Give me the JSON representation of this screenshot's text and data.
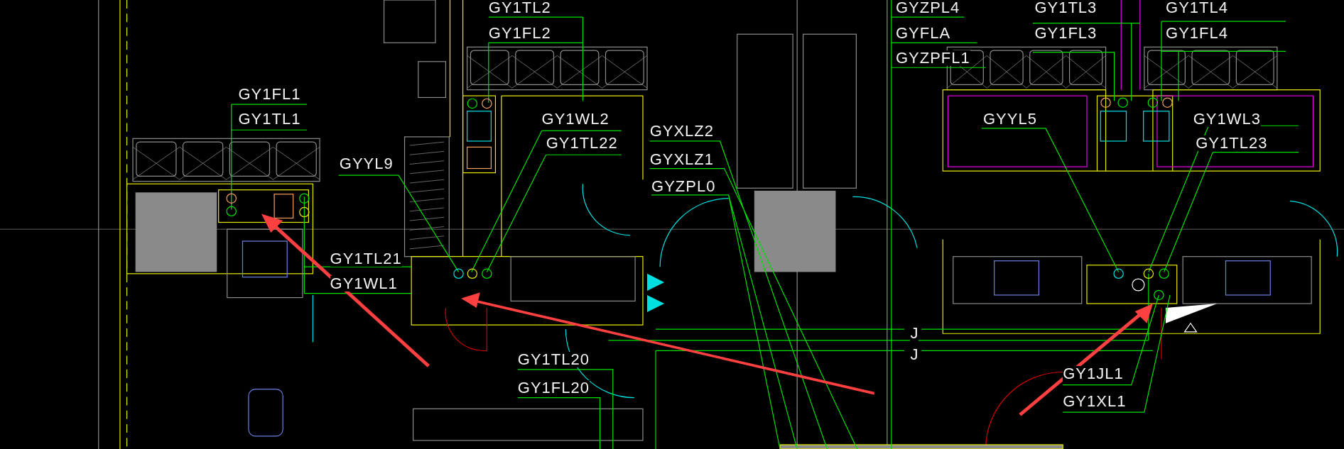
{
  "drawing": {
    "labels": [
      {
        "text": "GY1TL2"
      },
      {
        "text": "GY1FL2"
      },
      {
        "text": "GYZPL4"
      },
      {
        "text": "GY1TL3"
      },
      {
        "text": "GY1TL4"
      },
      {
        "text": "GYFLA"
      },
      {
        "text": "GY1FL3"
      },
      {
        "text": "GY1FL4"
      },
      {
        "text": "GYZPFL1"
      },
      {
        "text": "GY1FL1"
      },
      {
        "text": "GY1TL1"
      },
      {
        "text": "GY1WL2"
      },
      {
        "text": "GYYL5"
      },
      {
        "text": "GY1WL3"
      },
      {
        "text": "GYXLZ2"
      },
      {
        "text": "GY1TL22"
      },
      {
        "text": "GY1TL23"
      },
      {
        "text": "GYXLZ1"
      },
      {
        "text": "GYYL9"
      },
      {
        "text": "GYZPL0"
      },
      {
        "text": "GY1TL21"
      },
      {
        "text": "GY1WL1"
      },
      {
        "text": "J"
      },
      {
        "text": "J"
      },
      {
        "text": "GY1TL20"
      },
      {
        "text": "GY1JL1"
      },
      {
        "text": "GY1FL20"
      },
      {
        "text": "GY1XL1"
      }
    ]
  }
}
